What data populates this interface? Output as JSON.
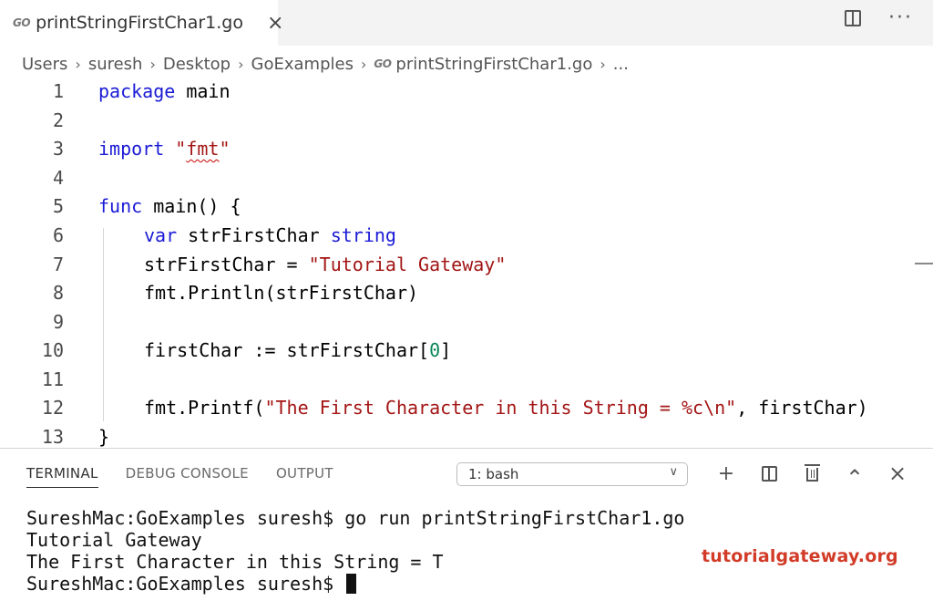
{
  "tab": {
    "icon_text": "GO",
    "title": "printStringFirstChar1.go",
    "close": "×"
  },
  "top_actions": {
    "more": "···"
  },
  "breadcrumb": {
    "items": [
      "Users",
      "suresh",
      "Desktop",
      "GoExamples"
    ],
    "icon_text": "GO",
    "file": "printStringFirstChar1.go",
    "ellipsis": "..."
  },
  "line_numbers": [
    "1",
    "2",
    "3",
    "4",
    "5",
    "6",
    "7",
    "8",
    "9",
    "10",
    "11",
    "12",
    "13"
  ],
  "code": {
    "l1_kw": "package",
    "l1_rest": " main",
    "l3_kw": "import",
    "l3_q1": " \"",
    "l3_pkg": "fmt",
    "l3_q2": "\"",
    "l5_kw": "func",
    "l5_rest": " main() {",
    "l6_kw": "var",
    "l6_mid": " strFirstChar ",
    "l6_type": "string",
    "l7_left": "strFirstChar = ",
    "l7_str": "\"Tutorial Gateway\"",
    "l8": "fmt.Println(strFirstChar)",
    "l10_left": "firstChar := strFirstChar[",
    "l10_num": "0",
    "l10_right": "]",
    "l12_left": "fmt.Printf(",
    "l12_str": "\"The First Character in this String = %c\\n\"",
    "l12_right": ", firstChar)",
    "l13": "}"
  },
  "panel": {
    "tabs": [
      "TERMINAL",
      "DEBUG CONSOLE",
      "OUTPUT"
    ],
    "shell_select": "1: bash",
    "actions": {
      "add": "+",
      "chevron_up": "⌃",
      "close": "×"
    }
  },
  "terminal": {
    "lines": [
      "SureshMac:GoExamples suresh$ go run printStringFirstChar1.go",
      "Tutorial Gateway",
      "The First Character in this String = T",
      "SureshMac:GoExamples suresh$ "
    ]
  },
  "watermark": "tutorialgateway.org"
}
